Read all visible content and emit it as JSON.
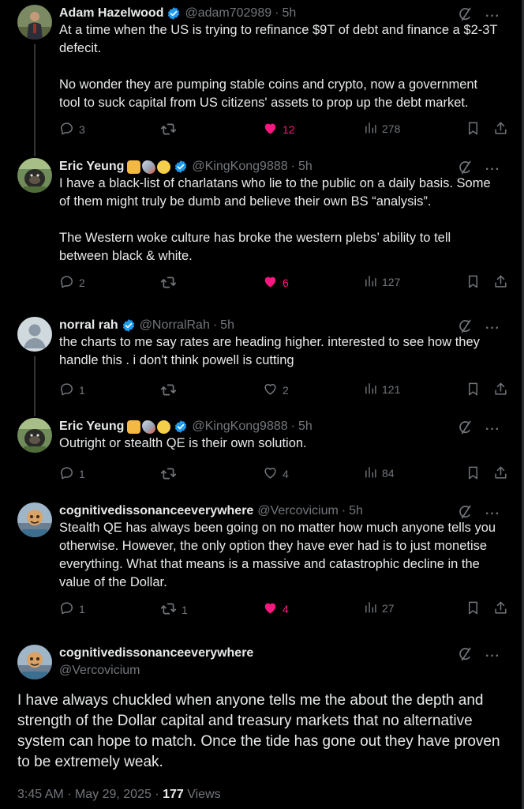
{
  "colors": {
    "background": "#000000",
    "text": "#e7e9ea",
    "muted": "#71767b",
    "like": "#f91880",
    "verified": "#1d9bf0"
  },
  "icons": {
    "reply": "reply-icon",
    "repost": "repost-icon",
    "like": "heart-icon",
    "views": "views-icon",
    "bookmark": "bookmark-icon",
    "share": "share-icon",
    "grok": "grok-icon",
    "more": "more-icon"
  },
  "replies": [
    {
      "name": "Adam Hazelwood",
      "handle": "@adam702989",
      "time": "5h",
      "verified": true,
      "emoji": [],
      "text": "At a time when the US is trying to refinance $9T of debt and finance a $2-3T defecit.\n\nNo wonder they are pumping stable coins and crypto, now a government tool to suck capital from US citizens' assets to prop up the debt market.",
      "reply_count": "3",
      "repost_count": "",
      "like_count": "12",
      "liked": true,
      "views": "278"
    },
    {
      "name": "Eric Yeung",
      "handle": "@KingKong9888",
      "time": "5h",
      "verified": true,
      "emoji": [
        "thumbs-up",
        "rocket",
        "yellow-circle"
      ],
      "text": "I have a black-list of charlatans who lie to the public on a daily basis. Some of them might truly be dumb and believe their own BS “analysis”.\n\nThe Western woke culture has broke the western plebs’ ability to tell between black & white.",
      "reply_count": "2",
      "repost_count": "",
      "like_count": "6",
      "liked": true,
      "views": "127"
    },
    {
      "name": "norral rah",
      "handle": "@NorralRah",
      "time": "5h",
      "verified": true,
      "emoji": [],
      "text": "the charts to me say rates are heading higher. interested to see how they handle this . i don't think powell is cutting",
      "reply_count": "1",
      "repost_count": "",
      "like_count": "2",
      "liked": false,
      "views": "121"
    },
    {
      "name": "Eric Yeung",
      "handle": "@KingKong9888",
      "time": "5h",
      "verified": true,
      "emoji": [
        "thumbs-up",
        "rocket",
        "yellow-circle"
      ],
      "text": "Outright or stealth QE is their own solution.",
      "reply_count": "1",
      "repost_count": "",
      "like_count": "4",
      "liked": false,
      "views": "84"
    },
    {
      "name": "cognitivedissonanceeverywhere",
      "handle": "@Vercovicium",
      "time": "5h",
      "verified": false,
      "emoji": [],
      "text": "Stealth QE has always been going on no matter how much anyone tells you otherwise. However, the only option they have ever had is to just monetise everything. What that means is a massive and catastrophic decline in the value of the Dollar.",
      "reply_count": "1",
      "repost_count": "1",
      "like_count": "4",
      "liked": true,
      "views": "27"
    }
  ],
  "main": {
    "name": "cognitivedissonanceeverywhere",
    "handle": "@Vercovicium",
    "text": "I have always chuckled when anyone tells me the about the depth and strength of the Dollar capital and treasury markets that no alternative system can hope to match. Once the tide has gone out they have proven to be extremely weak.",
    "timestamp": "3:45 AM · May 29, 2025 · ",
    "views_count": "177",
    "views_label": " Views"
  }
}
